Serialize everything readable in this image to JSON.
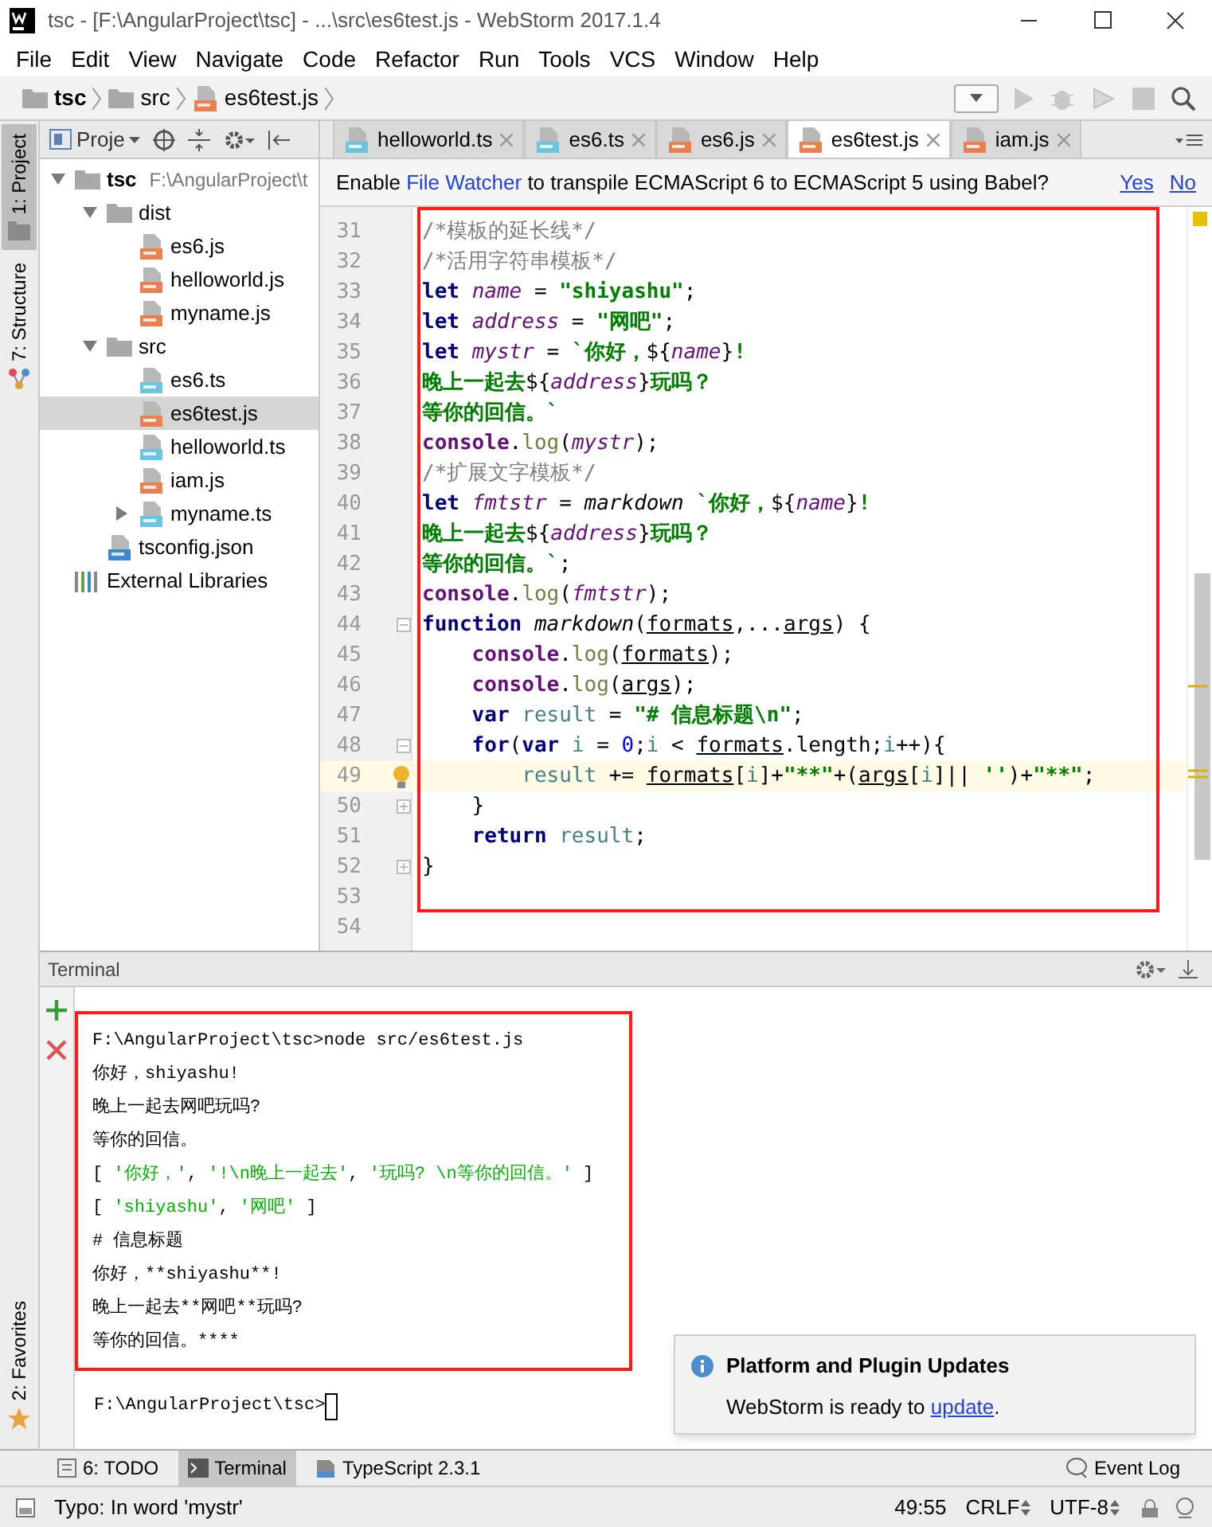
{
  "window": {
    "title": "tsc - [F:\\AngularProject\\tsc] - ...\\src\\es6test.js - WebStorm 2017.1.4"
  },
  "menu": [
    "File",
    "Edit",
    "View",
    "Navigate",
    "Code",
    "Refactor",
    "Run",
    "Tools",
    "VCS",
    "Window",
    "Help"
  ],
  "breadcrumbs": [
    {
      "label": "tsc",
      "kind": "project"
    },
    {
      "label": "src",
      "kind": "folder"
    },
    {
      "label": "es6test.js",
      "kind": "js"
    }
  ],
  "tool_strip": [
    {
      "label": "1: Project",
      "selected": true
    },
    {
      "label": "7: Structure",
      "selected": false
    }
  ],
  "favorites": {
    "label": "2: Favorites"
  },
  "project": {
    "title": "Proje",
    "tree": [
      {
        "name": "tsc",
        "path": "F:\\AngularProject\\t",
        "kind": "project",
        "expanded": true,
        "selected": false,
        "children": [
          {
            "name": "dist",
            "kind": "folder",
            "expanded": true,
            "selected": false,
            "children": [
              {
                "name": "es6.js",
                "kind": "js",
                "selected": false
              },
              {
                "name": "helloworld.js",
                "kind": "js",
                "selected": false
              },
              {
                "name": "myname.js",
                "kind": "js",
                "selected": false
              }
            ]
          },
          {
            "name": "src",
            "kind": "folder",
            "expanded": true,
            "selected": false,
            "children": [
              {
                "name": "es6.ts",
                "kind": "ts",
                "selected": false
              },
              {
                "name": "es6test.js",
                "kind": "js",
                "selected": true
              },
              {
                "name": "helloworld.ts",
                "kind": "ts",
                "selected": false
              },
              {
                "name": "iam.js",
                "kind": "js",
                "selected": false
              },
              {
                "name": "myname.ts",
                "kind": "ts",
                "expanded": false,
                "selected": false
              }
            ]
          },
          {
            "name": "tsconfig.json",
            "kind": "json",
            "selected": false
          }
        ]
      },
      {
        "name": "External Libraries",
        "kind": "libraries",
        "selected": false
      }
    ]
  },
  "editor_tabs": [
    {
      "label": "helloworld.ts",
      "kind": "ts",
      "selected": false
    },
    {
      "label": "es6.ts",
      "kind": "ts",
      "selected": false
    },
    {
      "label": "es6.js",
      "kind": "js",
      "selected": false
    },
    {
      "label": "es6test.js",
      "kind": "js",
      "selected": true
    },
    {
      "label": "iam.js",
      "kind": "js",
      "selected": false
    }
  ],
  "notification": {
    "before": "Enable ",
    "link": "File Watcher",
    "after": " to transpile ECMAScript 6 to ECMAScript 5 using Babel?",
    "actions": [
      "Yes",
      "No"
    ]
  },
  "code": {
    "lines": [
      {
        "number": "31",
        "current": false,
        "tokens": [
          {
            "kind": "comment",
            "text": "/*模板的延长线*/"
          }
        ]
      },
      {
        "number": "32",
        "current": false,
        "tokens": [
          {
            "kind": "comment",
            "text": "/*活用字符串模板*/"
          }
        ]
      },
      {
        "number": "33",
        "current": false,
        "tokens": [
          {
            "kind": "keyword",
            "text": "let "
          },
          {
            "kind": "variable",
            "text": "name"
          },
          {
            "kind": "plain",
            "text": " = "
          },
          {
            "kind": "string",
            "text": "\"shiyashu\""
          },
          {
            "kind": "plain",
            "text": ";"
          }
        ]
      },
      {
        "number": "34",
        "current": false,
        "tokens": [
          {
            "kind": "keyword",
            "text": "let "
          },
          {
            "kind": "variable",
            "text": "address"
          },
          {
            "kind": "plain",
            "text": " = "
          },
          {
            "kind": "string",
            "text": "\"网吧\""
          },
          {
            "kind": "plain",
            "text": ";"
          }
        ]
      },
      {
        "number": "35",
        "current": false,
        "tokens": [
          {
            "kind": "keyword",
            "text": "let "
          },
          {
            "kind": "variable",
            "text": "mystr"
          },
          {
            "kind": "plain",
            "text": " = "
          },
          {
            "kind": "string",
            "text": "`你好，"
          },
          {
            "kind": "plain",
            "text": "${"
          },
          {
            "kind": "variable",
            "text": "name"
          },
          {
            "kind": "plain",
            "text": "}"
          },
          {
            "kind": "string",
            "text": "!"
          }
        ]
      },
      {
        "number": "36",
        "current": false,
        "tokens": [
          {
            "kind": "string",
            "text": "晚上一起去"
          },
          {
            "kind": "plain",
            "text": "${"
          },
          {
            "kind": "variable",
            "text": "address"
          },
          {
            "kind": "plain",
            "text": "}"
          },
          {
            "kind": "string",
            "text": "玩吗？"
          }
        ]
      },
      {
        "number": "37",
        "current": false,
        "tokens": [
          {
            "kind": "string",
            "text": "等你的回信。`"
          }
        ]
      },
      {
        "number": "38",
        "current": false,
        "tokens": [
          {
            "kind": "object",
            "text": "console"
          },
          {
            "kind": "plain",
            "text": "."
          },
          {
            "kind": "method",
            "text": "log"
          },
          {
            "kind": "plain",
            "text": "("
          },
          {
            "kind": "variable",
            "text": "mystr"
          },
          {
            "kind": "plain",
            "text": ");"
          }
        ]
      },
      {
        "number": "39",
        "current": false,
        "tokens": [
          {
            "kind": "comment",
            "text": "/*扩展文字模板*/"
          }
        ]
      },
      {
        "number": "40",
        "current": false,
        "tokens": [
          {
            "kind": "keyword",
            "text": "let "
          },
          {
            "kind": "variable",
            "text": "fmtstr"
          },
          {
            "kind": "plain",
            "text": " = "
          },
          {
            "kind": "function",
            "text": "markdown "
          },
          {
            "kind": "string",
            "text": "`你好，"
          },
          {
            "kind": "plain",
            "text": "${"
          },
          {
            "kind": "variable",
            "text": "name"
          },
          {
            "kind": "plain",
            "text": "}"
          },
          {
            "kind": "string",
            "text": "!"
          }
        ]
      },
      {
        "number": "41",
        "current": false,
        "tokens": [
          {
            "kind": "string",
            "text": "晚上一起去"
          },
          {
            "kind": "plain",
            "text": "${"
          },
          {
            "kind": "variable",
            "text": "address"
          },
          {
            "kind": "plain",
            "text": "}"
          },
          {
            "kind": "string",
            "text": "玩吗？"
          }
        ]
      },
      {
        "number": "42",
        "current": false,
        "tokens": [
          {
            "kind": "string",
            "text": "等你的回信。`"
          },
          {
            "kind": "plain",
            "text": ";"
          }
        ]
      },
      {
        "number": "43",
        "current": false,
        "tokens": [
          {
            "kind": "object",
            "text": "console"
          },
          {
            "kind": "plain",
            "text": "."
          },
          {
            "kind": "method",
            "text": "log"
          },
          {
            "kind": "plain",
            "text": "("
          },
          {
            "kind": "variable",
            "text": "fmtstr"
          },
          {
            "kind": "plain",
            "text": ");"
          }
        ]
      },
      {
        "number": "44",
        "current": false,
        "fold_start": true,
        "tokens": [
          {
            "kind": "keyword",
            "text": "function "
          },
          {
            "kind": "function",
            "text": "markdown"
          },
          {
            "kind": "plain",
            "text": "("
          },
          {
            "kind": "param",
            "text": "formats"
          },
          {
            "kind": "plain",
            "text": ",..."
          },
          {
            "kind": "param",
            "text": "args"
          },
          {
            "kind": "plain",
            "text": ") {"
          }
        ]
      },
      {
        "number": "45",
        "current": false,
        "tokens": [
          {
            "kind": "object",
            "text": "    console"
          },
          {
            "kind": "plain",
            "text": "."
          },
          {
            "kind": "method",
            "text": "log"
          },
          {
            "kind": "plain",
            "text": "("
          },
          {
            "kind": "param",
            "text": "formats"
          },
          {
            "kind": "plain",
            "text": ");"
          }
        ]
      },
      {
        "number": "46",
        "current": false,
        "tokens": [
          {
            "kind": "object",
            "text": "    console"
          },
          {
            "kind": "plain",
            "text": "."
          },
          {
            "kind": "method",
            "text": "log"
          },
          {
            "kind": "plain",
            "text": "("
          },
          {
            "kind": "param",
            "text": "args"
          },
          {
            "kind": "plain",
            "text": ");"
          }
        ]
      },
      {
        "number": "47",
        "current": false,
        "tokens": [
          {
            "kind": "keyword",
            "text": "    var "
          },
          {
            "kind": "local",
            "text": "result"
          },
          {
            "kind": "plain",
            "text": " = "
          },
          {
            "kind": "string",
            "text": "\"# 信息标题\\n\""
          },
          {
            "kind": "plain",
            "text": ";"
          }
        ]
      },
      {
        "number": "48",
        "current": false,
        "fold_start": true,
        "tokens": [
          {
            "kind": "keyword",
            "text": "    for"
          },
          {
            "kind": "plain",
            "text": "("
          },
          {
            "kind": "keyword",
            "text": "var "
          },
          {
            "kind": "local",
            "text": "i"
          },
          {
            "kind": "plain",
            "text": " = "
          },
          {
            "kind": "number",
            "text": "0"
          },
          {
            "kind": "plain",
            "text": ";"
          },
          {
            "kind": "local",
            "text": "i"
          },
          {
            "kind": "plain",
            "text": " < "
          },
          {
            "kind": "param",
            "text": "formats"
          },
          {
            "kind": "plain",
            "text": ".length;"
          },
          {
            "kind": "local",
            "text": "i"
          },
          {
            "kind": "plain",
            "text": "++){"
          }
        ]
      },
      {
        "number": "49",
        "current": true,
        "hint": true,
        "tokens": [
          {
            "kind": "local",
            "text": "        result"
          },
          {
            "kind": "plain",
            "text": " += "
          },
          {
            "kind": "param",
            "text": "formats"
          },
          {
            "kind": "plain",
            "text": "["
          },
          {
            "kind": "local",
            "text": "i"
          },
          {
            "kind": "plain",
            "text": "]+"
          },
          {
            "kind": "string",
            "text": "\"**\""
          },
          {
            "kind": "plain",
            "text": "+("
          },
          {
            "kind": "param",
            "text": "args"
          },
          {
            "kind": "plain",
            "text": "["
          },
          {
            "kind": "local",
            "text": "i"
          },
          {
            "kind": "plain",
            "text": "]|| "
          },
          {
            "kind": "string",
            "text": "''"
          },
          {
            "kind": "plain",
            "text": ")+"
          },
          {
            "kind": "string",
            "text": "\"**\""
          },
          {
            "kind": "plain",
            "text": ";"
          }
        ]
      },
      {
        "number": "50",
        "current": false,
        "fold_end": true,
        "tokens": [
          {
            "kind": "plain",
            "text": "    }"
          }
        ]
      },
      {
        "number": "51",
        "current": false,
        "tokens": [
          {
            "kind": "keyword",
            "text": "    return "
          },
          {
            "kind": "local",
            "text": "result"
          },
          {
            "kind": "plain",
            "text": ";"
          }
        ]
      },
      {
        "number": "52",
        "current": false,
        "fold_end": true,
        "tokens": [
          {
            "kind": "plain",
            "text": "}"
          }
        ]
      },
      {
        "number": "53",
        "current": false
      },
      {
        "number": "54",
        "current": false
      }
    ]
  },
  "terminal": {
    "title": "Terminal",
    "lines": [
      [
        {
          "kind": "plain",
          "text": "F:\\AngularProject\\tsc>node src/es6test.js"
        }
      ],
      [
        {
          "kind": "plain",
          "text": "你好，shiyashu!"
        }
      ],
      [
        {
          "kind": "plain",
          "text": "晚上一起去网吧玩吗?"
        }
      ],
      [
        {
          "kind": "plain",
          "text": "等你的回信。"
        }
      ],
      [
        {
          "kind": "plain",
          "text": "[ "
        },
        {
          "kind": "string",
          "text": "'你好，'"
        },
        {
          "kind": "plain",
          "text": ", "
        },
        {
          "kind": "string",
          "text": "'!\\n晚上一起去'"
        },
        {
          "kind": "plain",
          "text": ", "
        },
        {
          "kind": "string",
          "text": "'玩吗? \\n等你的回信。'"
        },
        {
          "kind": "plain",
          "text": " ]"
        }
      ],
      [
        {
          "kind": "plain",
          "text": "[ "
        },
        {
          "kind": "string",
          "text": "'shiyashu'"
        },
        {
          "kind": "plain",
          "text": ", "
        },
        {
          "kind": "string",
          "text": "'网吧'"
        },
        {
          "kind": "plain",
          "text": " ]"
        }
      ],
      [
        {
          "kind": "plain",
          "text": "# 信息标题"
        }
      ],
      [
        {
          "kind": "plain",
          "text": "你好，**shiyashu**!"
        }
      ],
      [
        {
          "kind": "plain",
          "text": "晚上一起去**网吧**玩吗?"
        }
      ],
      [
        {
          "kind": "plain",
          "text": "等你的回信。****"
        }
      ]
    ],
    "prompt": "F:\\AngularProject\\tsc>"
  },
  "popup": {
    "title": "Platform and Plugin Updates",
    "before": "WebStorm is ready to ",
    "link": "update",
    "after": "."
  },
  "bottom_tabs": [
    {
      "label": "6: TODO",
      "kind": "todo",
      "selected": false
    },
    {
      "label": "Terminal",
      "kind": "terminal",
      "selected": true
    },
    {
      "label": "TypeScript 2.3.1",
      "kind": "typescript",
      "selected": false
    }
  ],
  "event_log": "Event Log",
  "status": {
    "message": "Typo: In word 'mystr'",
    "position": "49:55",
    "line_separator": "CRLF",
    "encoding": "UTF-8"
  }
}
